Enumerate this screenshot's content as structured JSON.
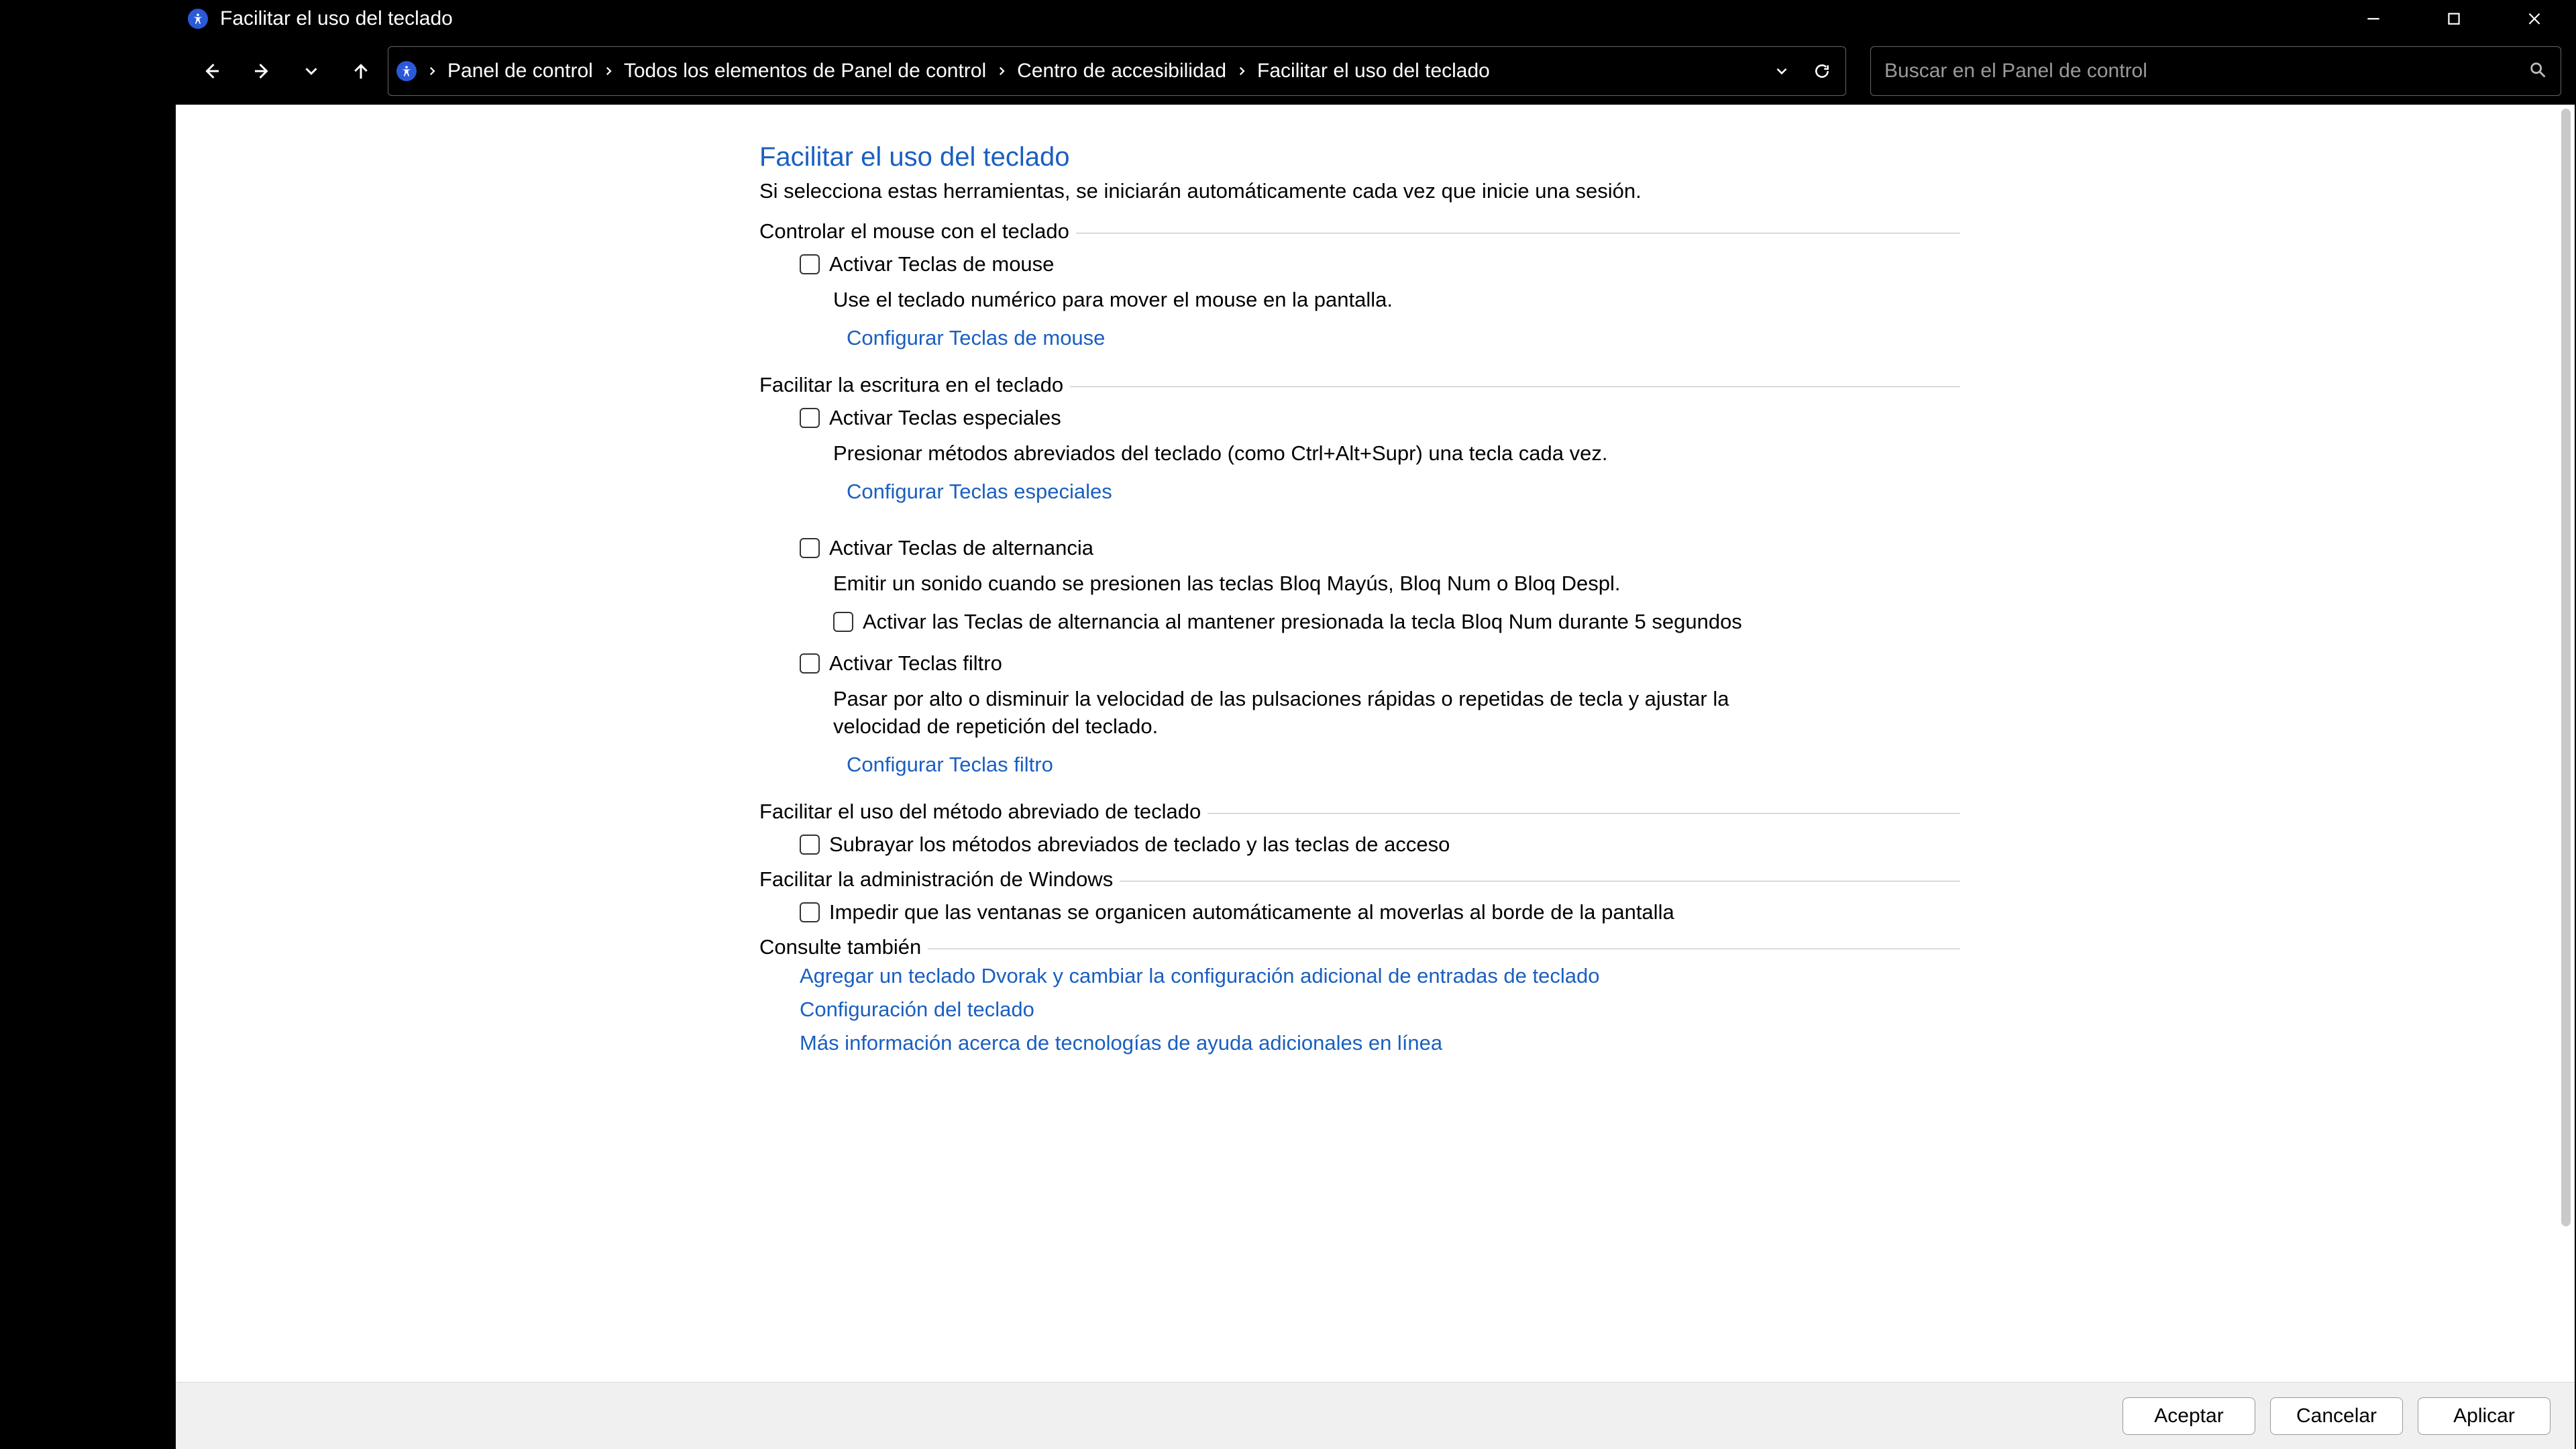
{
  "window_title": "Facilitar el uso del teclado",
  "breadcrumb": {
    "segments": [
      "Panel de control",
      "Todos los elementos de Panel de control",
      "Centro de accesibilidad",
      "Facilitar el uso del teclado"
    ]
  },
  "search": {
    "placeholder": "Buscar en el Panel de control"
  },
  "page": {
    "heading": "Facilitar el uso del teclado",
    "subtitle": "Si selecciona estas herramientas, se iniciarán automáticamente cada vez que inicie una sesión."
  },
  "groups": {
    "mouse": {
      "legend": "Controlar el mouse con el teclado",
      "opt1_label": "Activar Teclas de mouse",
      "opt1_desc": "Use el teclado numérico para mover el mouse en la pantalla.",
      "opt1_config": "Configurar Teclas de mouse"
    },
    "typing": {
      "legend": "Facilitar la escritura en el teclado",
      "sticky_label": "Activar Teclas especiales",
      "sticky_desc": "Presionar métodos abreviados del teclado (como Ctrl+Alt+Supr) una tecla cada vez.",
      "sticky_config": "Configurar Teclas especiales",
      "toggle_label": "Activar Teclas de alternancia",
      "toggle_desc": "Emitir un sonido cuando se presionen las teclas Bloq Mayús, Bloq Num o Bloq Despl.",
      "toggle_sub_label": "Activar las Teclas de alternancia al mantener presionada la tecla Bloq Num durante 5 segundos",
      "filter_label": "Activar Teclas filtro",
      "filter_desc": "Pasar por alto o disminuir la velocidad de las pulsaciones rápidas o repetidas de tecla y ajustar la velocidad de repetición del teclado.",
      "filter_config": "Configurar Teclas filtro"
    },
    "shortcuts": {
      "legend": "Facilitar el uso del método abreviado de teclado",
      "underline_label": "Subrayar los métodos abreviados de teclado y las teclas de acceso"
    },
    "windows_admin": {
      "legend": "Facilitar la administración de Windows",
      "snap_label": "Impedir que las ventanas se organicen automáticamente al moverlas al borde de la pantalla"
    },
    "see_also": {
      "legend": "Consulte también",
      "link1": "Agregar un teclado Dvorak y cambiar la configuración adicional de entradas de teclado",
      "link2": "Configuración del teclado",
      "link3": "Más información acerca de tecnologías de ayuda adicionales en línea"
    }
  },
  "buttons": {
    "ok": "Aceptar",
    "cancel": "Cancelar",
    "apply": "Aplicar"
  }
}
